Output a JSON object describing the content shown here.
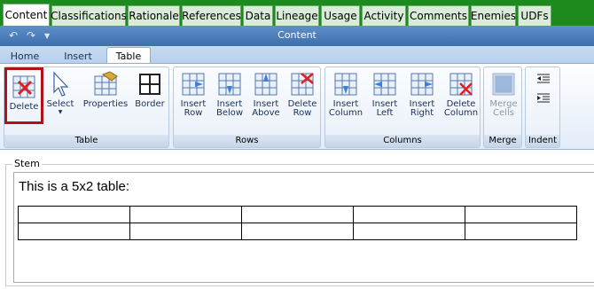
{
  "top_tabs": [
    "Content",
    "Classifications",
    "Rationale",
    "References",
    "Data",
    "Lineage",
    "Usage",
    "Activity",
    "Comments",
    "Enemies",
    "UDFs"
  ],
  "title_bar": {
    "title": "Content"
  },
  "ribbon_tabs": [
    "Home",
    "Insert",
    "Table"
  ],
  "groups": {
    "table": "Table",
    "rows": "Rows",
    "columns": "Columns",
    "merge": "Merge",
    "indent": "Indent"
  },
  "buttons": {
    "delete": "Delete",
    "select": "Select",
    "properties": "Properties",
    "border": "Border",
    "insert_row_l1": "Insert",
    "insert_row_l2": "Row",
    "insert_below_l1": "Insert",
    "insert_below_l2": "Below",
    "insert_above_l1": "Insert",
    "insert_above_l2": "Above",
    "delete_row_l1": "Delete",
    "delete_row_l2": "Row",
    "insert_column_l1": "Insert",
    "insert_column_l2": "Column",
    "insert_left_l1": "Insert",
    "insert_left_l2": "Left",
    "insert_right_l1": "Insert",
    "insert_right_l2": "Right",
    "delete_column_l1": "Delete",
    "delete_column_l2": "Column",
    "merge_cells_l1": "Merge",
    "merge_cells_l2": "Cells"
  },
  "stem": {
    "label": "Stem",
    "text": "This is a 5x2 table:",
    "table_rows": 2,
    "table_cols": 5
  },
  "colors": {
    "tab_strip": "#1d8a1d",
    "title_bar": "#4a7cbd",
    "highlight": "#b1121a"
  }
}
